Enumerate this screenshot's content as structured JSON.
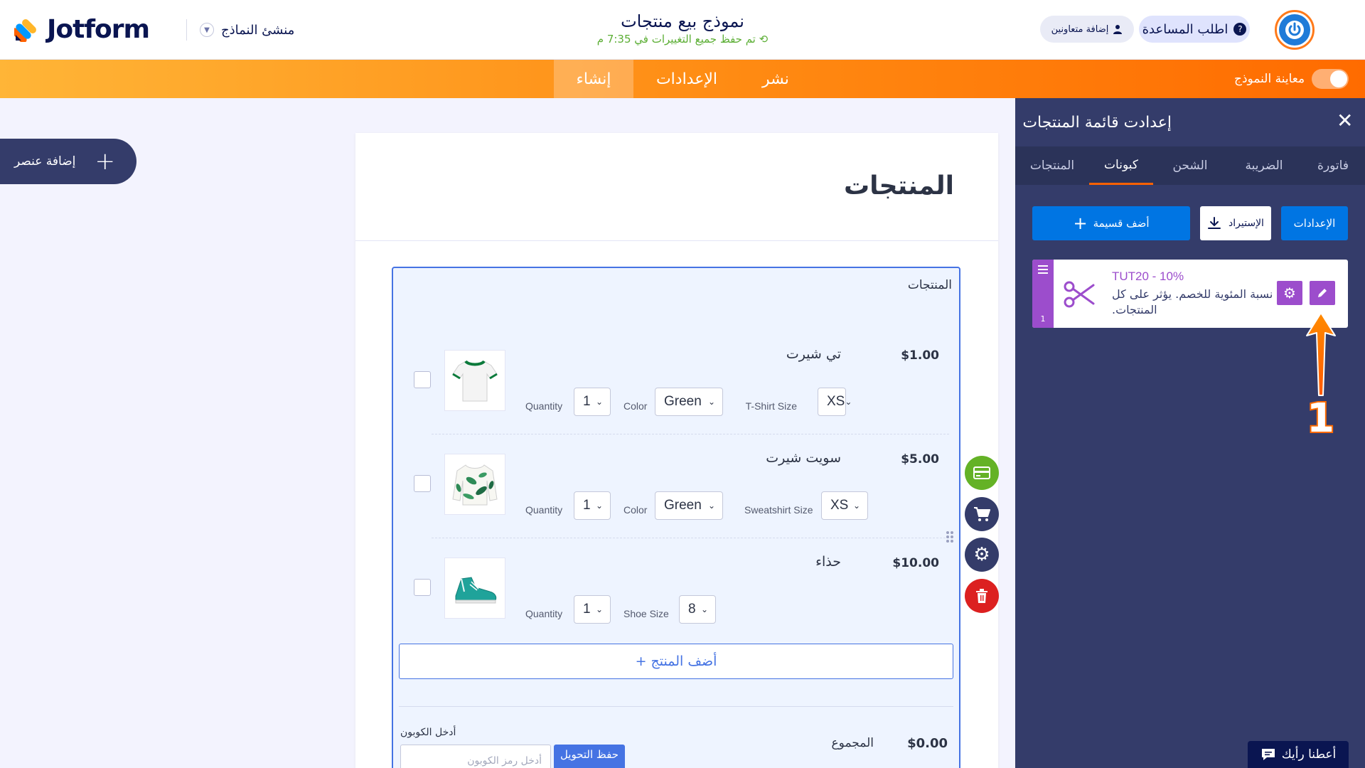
{
  "header": {
    "brand": "Jotform",
    "builder_label": "منشئ النماذج",
    "form_title": "نموذج بيع منتجات",
    "save_status": "تم حفظ جميع التغييرات في 7:35 م",
    "help_label": "اطلب المساعدة",
    "collab_label": "إضافة متعاونين",
    "accent": "#ff6100"
  },
  "nav": {
    "tabs": [
      "إنشاء",
      "الإعدادات",
      "نشر"
    ],
    "active_tab": "إنشاء",
    "preview_label": "معاينة النموذج"
  },
  "sidebar": {
    "add_element_label": "إضافة عنصر"
  },
  "form": {
    "heading": "المنتجات",
    "field_label": "المنتجات",
    "products": [
      {
        "name": "تي شيرت",
        "price": "$1.00",
        "image": "tshirt-icon",
        "options": [
          {
            "label": "T-Shirt Size",
            "value": "XS"
          },
          {
            "label": "Color",
            "value": "Green"
          },
          {
            "label": "Quantity",
            "value": "1"
          }
        ]
      },
      {
        "name": "سويت شيرت",
        "price": "$5.00",
        "image": "sweatshirt-icon",
        "options": [
          {
            "label": "Sweatshirt Size",
            "value": "XS"
          },
          {
            "label": "Color",
            "value": "Green"
          },
          {
            "label": "Quantity",
            "value": "1"
          }
        ]
      },
      {
        "name": "حذاء",
        "price": "$10.00",
        "image": "shoe-icon",
        "options": [
          {
            "label": "Shoe Size",
            "value": "8"
          },
          {
            "label": "Quantity",
            "value": "1"
          }
        ]
      }
    ],
    "add_product_label": "أضف المنتج +",
    "total_label": "المجموع",
    "total_amount": "$0.00",
    "coupon_label": "أدخل الكوبون",
    "coupon_placeholder": "أدخل رمز الكوبون",
    "coupon_apply_label": "حفظ التحويل"
  },
  "panel": {
    "title": "إعدادت قائمة المنتجات",
    "tabs": [
      "فاتورة",
      "الضريبة",
      "الشحن",
      "كبونات",
      "المنتجات"
    ],
    "active_tab": "كبونات",
    "settings_label": "الإعدادات",
    "import_label": "الإستيراد",
    "add_coupon_label": "أضف قسيمة",
    "coupon": {
      "code": "TUT20 - 10%",
      "description": "نسبة المئوية للخصم. يؤثر على كل المنتجات.",
      "index": "1",
      "color": "#9c4dcc"
    }
  },
  "annotation": {
    "number": "1"
  },
  "feedback_label": "أعطنا رأيك"
}
